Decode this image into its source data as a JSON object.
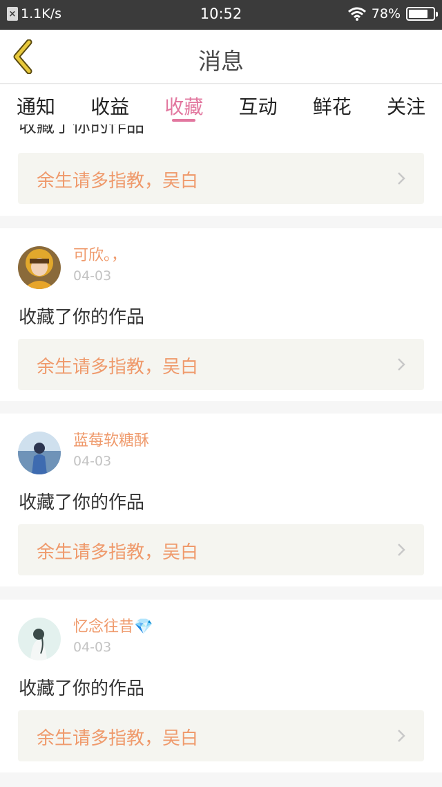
{
  "status_bar": {
    "net_speed": "1.1K/s",
    "time": "10:52",
    "battery": "78%",
    "battery_level": 0.78
  },
  "header": {
    "title": "消息"
  },
  "tabs": [
    {
      "label": "通知",
      "active": false
    },
    {
      "label": "收益",
      "active": false
    },
    {
      "label": "收藏",
      "active": true
    },
    {
      "label": "互动",
      "active": false
    },
    {
      "label": "鲜花",
      "active": false
    },
    {
      "label": "关注",
      "active": false
    }
  ],
  "feed": {
    "partial_card": {
      "action": "收藏了你的作品",
      "work_title": "余生请多指教，吴白"
    },
    "items": [
      {
        "user": "可欣。，",
        "date": "04-03",
        "action": "收藏了你的作品",
        "work_title": "余生请多指教，吴白"
      },
      {
        "user": "蓝莓软糖酥",
        "date": "04-03",
        "action": "收藏了你的作品",
        "work_title": "余生请多指教，吴白"
      },
      {
        "user": "忆念往昔💎",
        "date": "04-03",
        "action": "收藏了你的作品",
        "work_title": "余生请多指教，吴白"
      }
    ]
  },
  "colors": {
    "accent": "#e2779f",
    "username": "#ef9a6c",
    "work_title": "#ef9a6c",
    "back_arrow": "#e8c93c"
  }
}
